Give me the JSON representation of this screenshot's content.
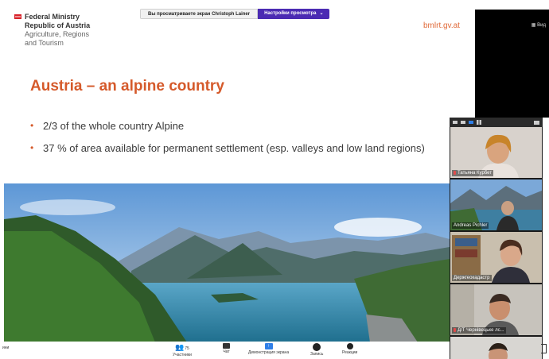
{
  "share_banner": {
    "message": "Вы просматриваете экран Christoph Lainer",
    "options_label": "Настройки просмотра",
    "caret": "⌄"
  },
  "view_button": "Вид",
  "slide": {
    "ministry": [
      "Federal Ministry",
      "Republic of Austria",
      "Agriculture, Regions",
      "and Tourism"
    ],
    "domain": "bmlrt.gv.at",
    "title": "Austria – an alpine country",
    "bullets": [
      "2/3 of the whole country Alpine",
      "37 % of area available for permanent settlement (esp. valleys and low land regions)"
    ]
  },
  "participants": [
    {
      "name": "Татьяна Курбет",
      "muted": true
    },
    {
      "name": "Andreas Pichler",
      "muted": false
    },
    {
      "name": "Держгеокадастр",
      "muted": false
    },
    {
      "name": "Д/Т Чернівецьке лс...",
      "muted": true
    },
    {
      "name": "",
      "muted": false
    }
  ],
  "toolbar": {
    "left_text": "ини",
    "participants_count": "75",
    "participants_label": "Участники",
    "chat_label": "Чат",
    "share_label": "Демонстрация экрана",
    "record_label": "Запись",
    "reactions_label": "Реакции"
  },
  "colors": {
    "title": "#d55a2b",
    "share_purple": "#4b2bb3",
    "panel_bg": "#1a1a1a"
  }
}
